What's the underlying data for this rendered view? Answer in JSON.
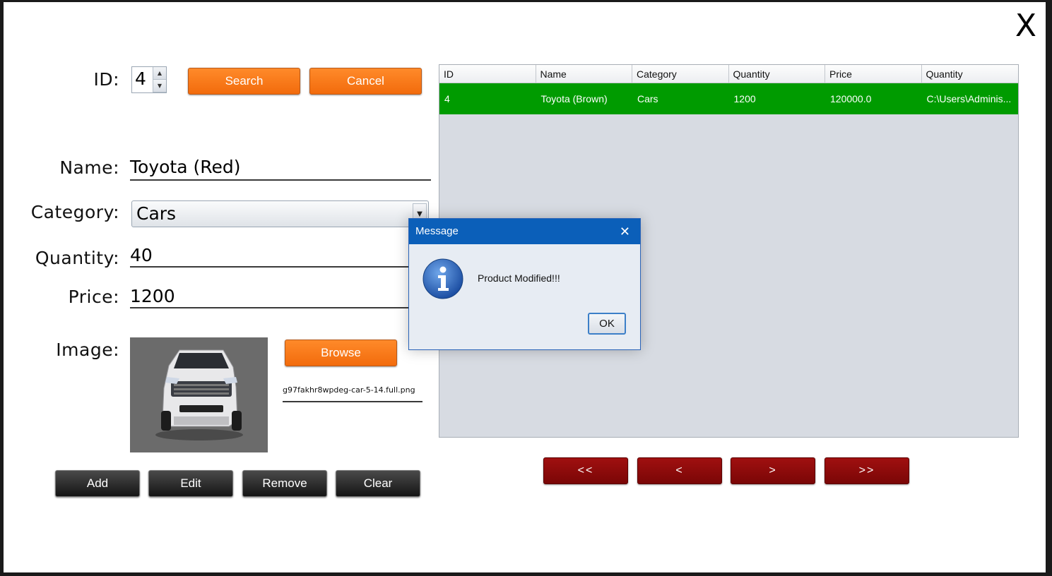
{
  "window": {
    "close_label": "X"
  },
  "form": {
    "id_label": "ID:",
    "id_value": "4",
    "name_label": "Name:",
    "name_value": "Toyota (Red)",
    "category_label": "Category:",
    "category_value": "Cars",
    "quantity_label": "Quantity:",
    "quantity_value": "40",
    "price_label": "Price:",
    "price_value": "1200",
    "image_label": "Image:",
    "image_filename": "g97fakhr8wpdeg-car-5-14.full.png"
  },
  "buttons": {
    "search": "Search",
    "cancel": "Cancel",
    "browse": "Browse",
    "add": "Add",
    "edit": "Edit",
    "remove": "Remove",
    "clear": "Clear"
  },
  "nav": {
    "first": "<<",
    "prev": "<",
    "next": ">",
    "last": ">>"
  },
  "table": {
    "headers": [
      "ID",
      "Name",
      "Category",
      "Quantity",
      "Price",
      "Quantity"
    ],
    "rows": [
      [
        "4",
        "Toyota (Brown)",
        "Cars",
        "1200",
        "120000.0",
        "C:\\Users\\Adminis..."
      ]
    ],
    "selected_row_color": "#009b00"
  },
  "dialog": {
    "title": "Message",
    "message": "Product Modified!!!",
    "ok_label": "OK",
    "icon": "info-icon",
    "title_bar_color": "#0b5fb9"
  },
  "colors": {
    "orange_button": "#f26b0c",
    "dark_button": "#151515",
    "red_button": "#8b0a0a"
  }
}
